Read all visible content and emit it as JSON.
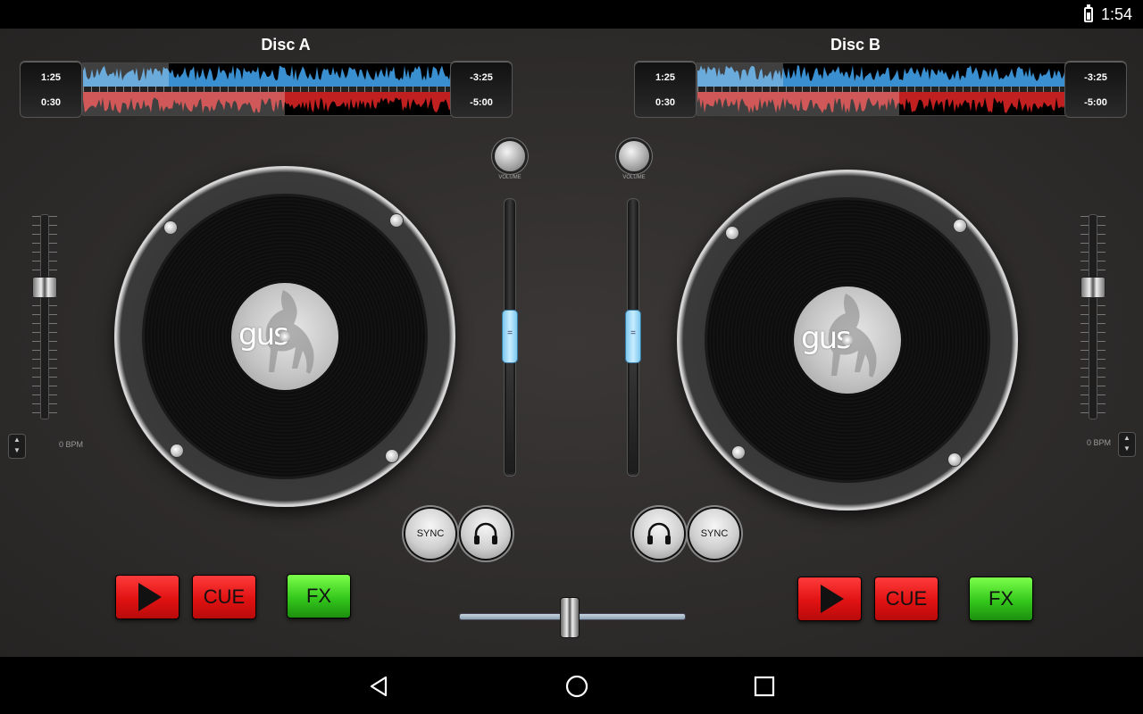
{
  "status": {
    "time": "1:54"
  },
  "deckA": {
    "title": "Disc A",
    "elapsed_top": "1:25",
    "elapsed_bottom": "0:30",
    "remain_top": "-3:25",
    "remain_bottom": "-5:00",
    "bpm": "0 BPM",
    "volume_label": "VOLUME",
    "sync_label": "SYNC",
    "cue_label": "CUE",
    "fx_label": "FX",
    "record_label": "gus"
  },
  "deckB": {
    "title": "Disc B",
    "elapsed_top": "1:25",
    "elapsed_bottom": "0:30",
    "remain_top": "-3:25",
    "remain_bottom": "-5:00",
    "bpm": "0 BPM",
    "volume_label": "VOLUME",
    "sync_label": "SYNC",
    "cue_label": "CUE",
    "fx_label": "FX",
    "record_label": "gus"
  },
  "colors": {
    "wave_blue": "#3a8fd0",
    "wave_red": "#c02020",
    "play_red": "#e01212",
    "fx_green": "#34c81c",
    "volume_thumb": "#a8dcf5"
  },
  "icons": {
    "play": "play-icon",
    "headphones": "headphones-icon",
    "back": "back-icon",
    "home": "home-icon",
    "recents": "recents-icon"
  }
}
